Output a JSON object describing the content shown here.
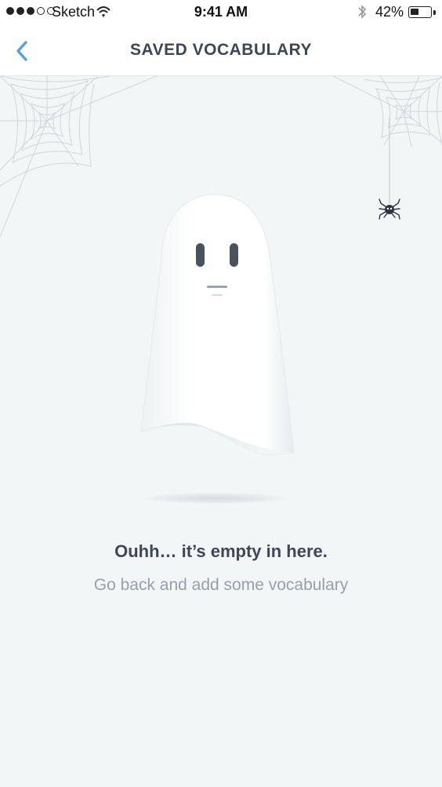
{
  "status_bar": {
    "carrier": "Sketch",
    "time": "9:41 AM",
    "battery_percent": "42%",
    "battery_level": 0.42,
    "signal_bars_filled": 3,
    "signal_bars_total": 5,
    "icons": [
      "signal-dots-icon",
      "wifi-icon",
      "bluetooth-icon",
      "battery-icon"
    ]
  },
  "nav": {
    "title": "SAVED VOCABULARY",
    "back_icon": "chevron-left-icon",
    "accent_color": "#5aa3cf"
  },
  "empty_state": {
    "title": "Ouhh… it’s empty in here.",
    "subtitle": "Go back and add some vocabulary",
    "illustration": [
      "ghost-icon",
      "cobweb-icon",
      "spider-icon"
    ]
  },
  "colors": {
    "background": "#f3f6f7",
    "title_text": "#3f4752",
    "subtitle_text": "#97a0a8"
  }
}
